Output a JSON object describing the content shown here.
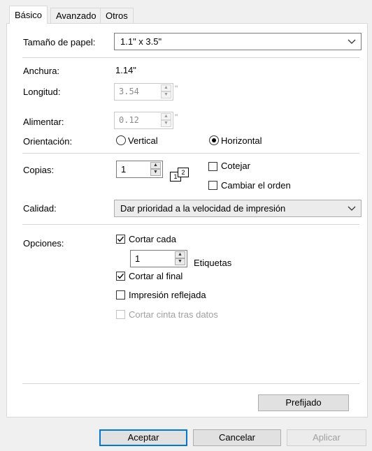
{
  "tabs": [
    {
      "label": "Básico"
    },
    {
      "label": "Avanzado"
    },
    {
      "label": "Otros"
    }
  ],
  "paper": {
    "label": "Tamaño de papel:",
    "value": "1.1\" x 3.5\""
  },
  "width": {
    "label": "Anchura:",
    "value": "1.14\""
  },
  "length": {
    "label": "Longitud:",
    "value": "3.54",
    "unit": "\""
  },
  "feed": {
    "label": "Alimentar:",
    "value": "0.12",
    "unit": "\""
  },
  "orientation": {
    "label": "Orientación:",
    "options": [
      {
        "label": "Vertical",
        "selected": false
      },
      {
        "label": "Horizontal",
        "selected": true
      }
    ]
  },
  "copies": {
    "label": "Copias:",
    "value": "1",
    "collate_label": "Cotejar",
    "collate_checked": false,
    "reverse_label": "Cambiar el orden",
    "reverse_checked": false,
    "icon_pages": [
      "1",
      "2"
    ]
  },
  "quality": {
    "label": "Calidad:",
    "value": "Dar prioridad  a la velocidad de impresión"
  },
  "options": {
    "label": "Opciones:",
    "cut_every_label": "Cortar cada",
    "cut_every_checked": true,
    "cut_every_value": "1",
    "labels_unit": "Etiquetas",
    "cut_at_end_label": "Cortar al final",
    "cut_at_end_checked": true,
    "mirror_label": "Impresión reflejada",
    "mirror_checked": false,
    "cut_tape_label": "Cortar cinta tras datos",
    "cut_tape_checked": false
  },
  "buttons": {
    "default_label": "Prefijado",
    "ok_label": "Aceptar",
    "cancel_label": "Cancelar",
    "apply_label": "Aplicar"
  }
}
